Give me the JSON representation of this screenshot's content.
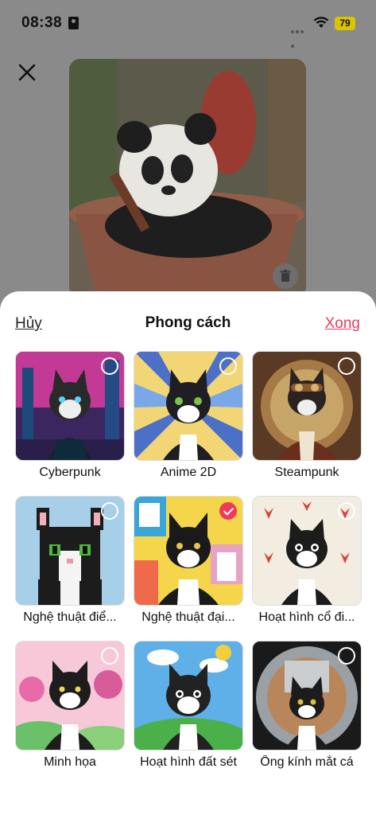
{
  "status_bar": {
    "time": "08:38",
    "battery": "79"
  },
  "sheet": {
    "cancel_label": "Hủy",
    "title": "Phong cách",
    "done_label": "Xong"
  },
  "styles": [
    {
      "label": "Cyberpunk",
      "selected": false
    },
    {
      "label": "Anime 2D",
      "selected": false
    },
    {
      "label": "Steampunk",
      "selected": false
    },
    {
      "label": "Nghệ thuật điể...",
      "selected": false
    },
    {
      "label": "Nghệ thuật đại...",
      "selected": true
    },
    {
      "label": "Hoạt hình cổ đi...",
      "selected": false
    },
    {
      "label": "Minh họa",
      "selected": false
    },
    {
      "label": "Hoạt hình đất sét",
      "selected": false
    },
    {
      "label": "Ống kính mắt cá",
      "selected": false
    }
  ],
  "colors": {
    "accent": "#ec3b5a"
  }
}
